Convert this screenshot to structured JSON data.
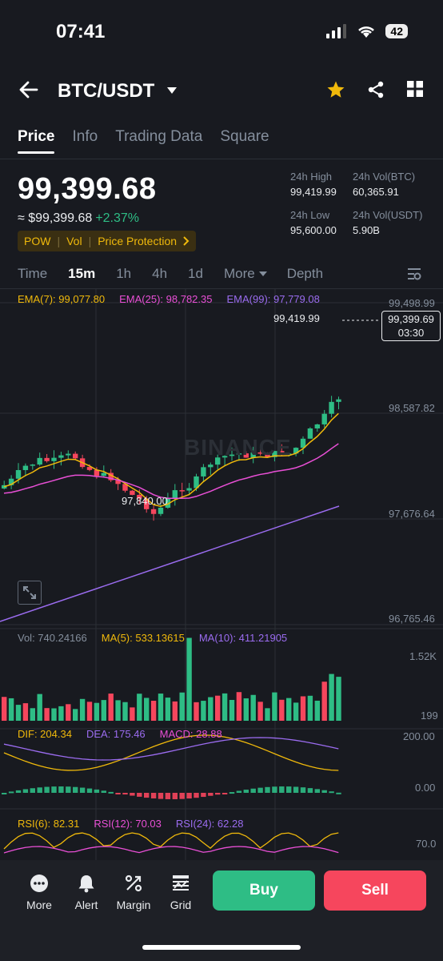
{
  "status": {
    "time": "07:41",
    "battery": "42"
  },
  "header": {
    "pair": "BTC/USDT"
  },
  "tabs": [
    "Price",
    "Info",
    "Trading Data",
    "Square"
  ],
  "price": {
    "last": "99,399.68",
    "fiat": "≈ $99,399.68",
    "change": "+2.37%",
    "tags": [
      "POW",
      "Vol",
      "Price Protection"
    ]
  },
  "stats": {
    "high_label": "24h High",
    "high": "99,419.99",
    "volbtc_label": "24h Vol(BTC)",
    "volbtc": "60,365.91",
    "low_label": "24h Low",
    "low": "95,600.00",
    "volusdt_label": "24h Vol(USDT)",
    "volusdt": "5.90B"
  },
  "intervals": {
    "time": "Time",
    "m15": "15m",
    "h1": "1h",
    "h4": "4h",
    "d1": "1d",
    "more": "More",
    "depth": "Depth"
  },
  "ema": {
    "ema7": "EMA(7): 99,077.80",
    "ema25": "EMA(25): 98,782.35",
    "ema99": "EMA(99): 97,779.08"
  },
  "axis": {
    "p1": "99,498.99",
    "p2": "98,587.82",
    "p3": "97,676.64",
    "p4": "96,765.46"
  },
  "marks": {
    "high": "99,419.99",
    "low": "97,840.00",
    "current": "99,399.69",
    "countdown": "03:30"
  },
  "watermark": "BINANCE",
  "volume": {
    "vol": "Vol: 740.24166",
    "ma5": "MA(5): 533.13615",
    "ma10": "MA(10): 411.21905",
    "top": "1.52K",
    "bottom": "199"
  },
  "macd": {
    "dif": "DIF: 204.34",
    "dea": "DEA: 175.46",
    "macd": "MACD: 28.88",
    "top": "200.00",
    "zero": "0.00"
  },
  "rsi": {
    "r6": "RSI(6): 82.31",
    "r12": "RSI(12): 70.03",
    "r24": "RSI(24): 62.28",
    "level": "70.0"
  },
  "bottom": {
    "more": "More",
    "alert": "Alert",
    "margin": "Margin",
    "grid": "Grid",
    "buy": "Buy",
    "sell": "Sell"
  },
  "colors": {
    "up": "#2ebd85",
    "down": "#f6465d",
    "accent": "#f0b90b",
    "ema7": "#f0b90b",
    "ema25": "#e94fd6",
    "ema99": "#9b6cf0"
  }
}
